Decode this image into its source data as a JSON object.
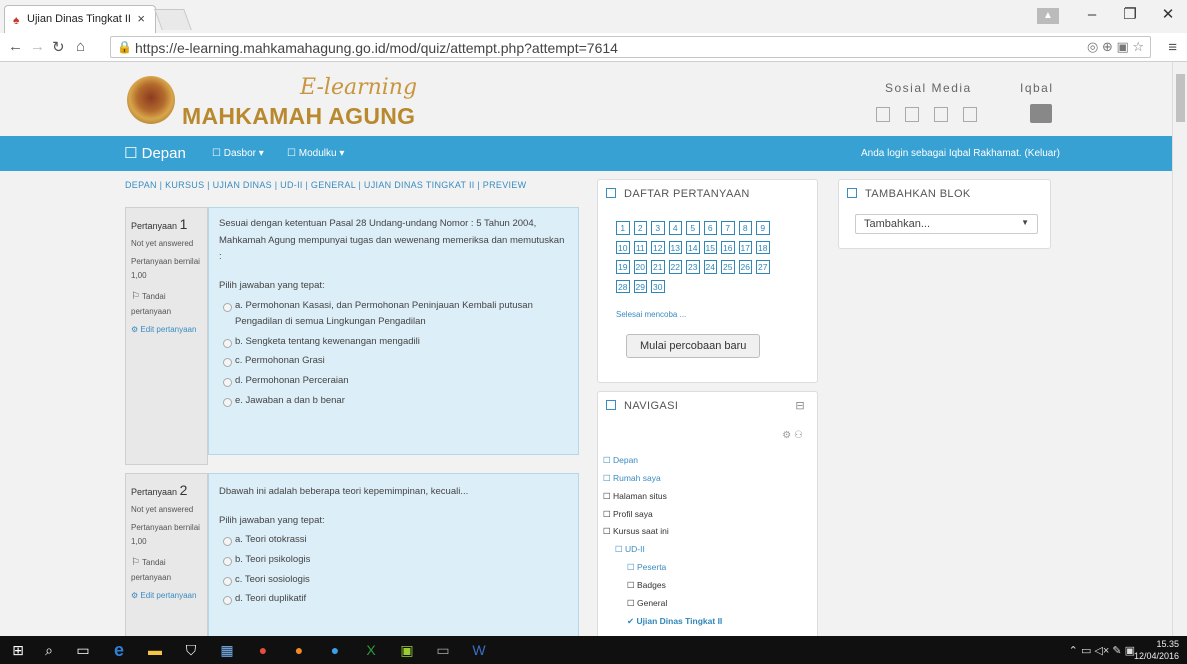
{
  "browser": {
    "tab_title": "Ujian Dinas Tingkat II",
    "url": "https://e-learning.mahkamahagung.go.id/mod/quiz/attempt.php?attempt=7614"
  },
  "header": {
    "brand_top": "E-learning",
    "brand_bottom": "MAHKAMAH AGUNG",
    "social_label": "Sosial Media",
    "user_name": "Iqbal"
  },
  "navbar": {
    "home": "Depan",
    "dasbor": "Dasbor",
    "modulku": "Modulku",
    "login_text": "Anda login sebagai Iqbal Rakhamat. (Keluar)"
  },
  "breadcrumb": "DEPAN | KURSUS | UJIAN DINAS | UD-II | GENERAL | UJIAN DINAS TINGKAT II | PREVIEW",
  "questions": [
    {
      "label": "Pertanyaan",
      "number": "1",
      "status": "Not yet answered",
      "mark_label": "Pertanyaan bernilai",
      "mark_value": "1,00",
      "flag": "Tandai pertanyaan",
      "edit": "Edit pertanyaan",
      "text": "Sesuai dengan ketentuan Pasal 28 Undang-undang Nomor : 5 Tahun 2004, Mahkamah Agung mempunyai tugas dan wewenang memeriksa dan memutuskan :",
      "prompt": "Pilih jawaban yang tepat:",
      "options": [
        "a. Permohonan Kasasi, dan Permohonan Peninjauan Kembali putusan Pengadilan di semua Lingkungan Pengadilan",
        "b. Sengketa tentang kewenangan mengadili",
        "c. Permohonan Grasi",
        "d. Permohonan Perceraian",
        "e. Jawaban a dan b benar"
      ]
    },
    {
      "label": "Pertanyaan",
      "number": "2",
      "status": "Not yet answered",
      "mark_label": "Pertanyaan bernilai",
      "mark_value": "1,00",
      "flag": "Tandai pertanyaan",
      "edit": "Edit pertanyaan",
      "text": "Dbawah ini adalah beberapa teori kepemimpinan, kecuali...",
      "prompt": "Pilih jawaban yang tepat:",
      "options": [
        "a. Teori otokrassi",
        "b. Teori psikologis",
        "c. Teori sosiologis",
        "d. Teori duplikatif"
      ]
    }
  ],
  "daftar": {
    "title": "DAFTAR PERTANYAAN",
    "numbers": [
      "1",
      "2",
      "3",
      "4",
      "5",
      "6",
      "7",
      "8",
      "9",
      "10",
      "11",
      "12",
      "13",
      "14",
      "15",
      "16",
      "17",
      "18",
      "19",
      "20",
      "21",
      "22",
      "23",
      "24",
      "25",
      "26",
      "27",
      "28",
      "29",
      "30"
    ],
    "finish": "Selesai mencoba ...",
    "restart": "Mulai percobaan baru"
  },
  "navigasi": {
    "title": "NAVIGASI",
    "items": [
      "Depan",
      "Rumah saya",
      "Halaman situs",
      "Profil saya",
      "Kursus saat ini",
      "UD-II",
      "Peserta",
      "Badges",
      "General",
      "Ujian Dinas Tingkat II"
    ]
  },
  "tambah": {
    "title": "TAMBAHKAN BLOK",
    "select": "Tambahkan..."
  },
  "taskbar": {
    "time": "15.35",
    "date": "12/04/2016"
  }
}
